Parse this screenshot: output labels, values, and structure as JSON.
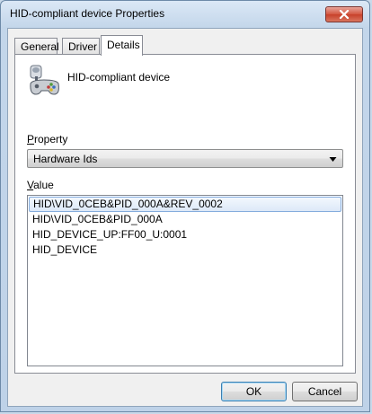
{
  "window": {
    "title": "HID-compliant device Properties",
    "close_icon": "close-x-icon"
  },
  "tabs": [
    {
      "label": "General"
    },
    {
      "label": "Driver"
    },
    {
      "label": "Details",
      "active": true
    }
  ],
  "device": {
    "icon": "game-controller-device-icon",
    "name": "HID-compliant device"
  },
  "property": {
    "label_accel": "P",
    "label_rest": "roperty",
    "selected": "Hardware Ids"
  },
  "value": {
    "label_accel": "V",
    "label_rest": "alue",
    "items": [
      "HID\\VID_0CEB&PID_000A&REV_0002",
      "HID\\VID_0CEB&PID_000A",
      "HID_DEVICE_UP:FF00_U:0001",
      "HID_DEVICE"
    ],
    "selected_index": 0
  },
  "buttons": {
    "ok": "OK",
    "cancel": "Cancel"
  }
}
